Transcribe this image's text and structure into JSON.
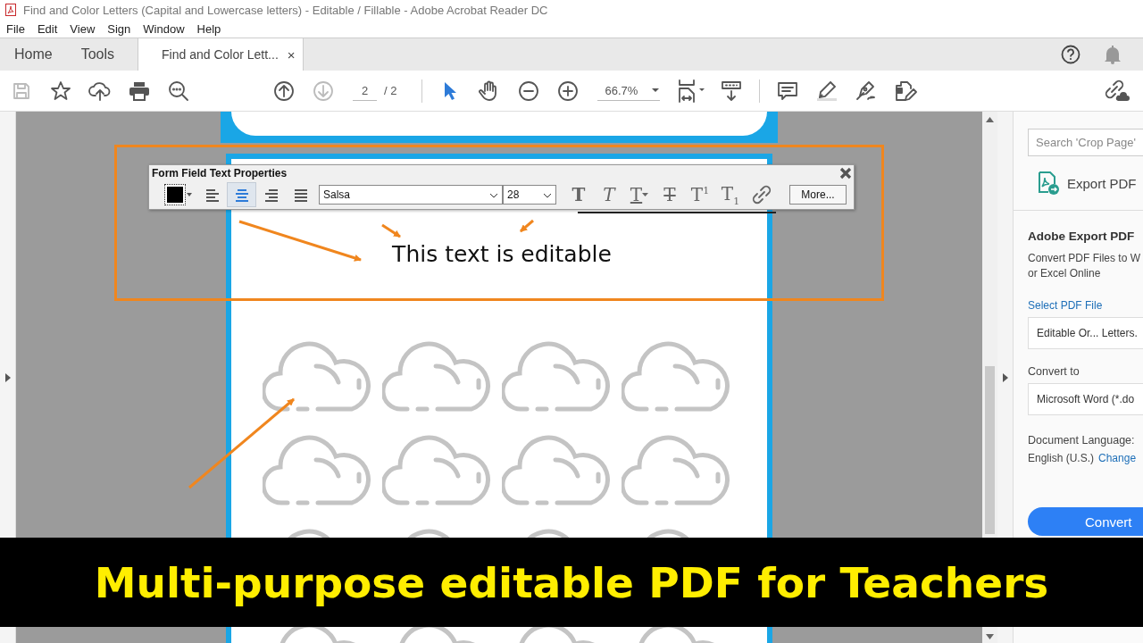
{
  "window": {
    "title": "Find and Color Letters (Capital and Lowercase letters) - Editable / Fillable - Adobe Acrobat Reader DC"
  },
  "menu": [
    "File",
    "Edit",
    "View",
    "Sign",
    "Window",
    "Help"
  ],
  "tabs": [
    {
      "label": "Home",
      "selected": false
    },
    {
      "label": "Tools",
      "selected": false
    },
    {
      "label": "Find and Color Lett...",
      "selected": true,
      "close": "×"
    }
  ],
  "toolbar": {
    "tools": [
      {
        "kind": "save",
        "disabled": true
      },
      {
        "kind": "star",
        "disabled": false
      },
      {
        "kind": "upload",
        "disabled": false
      },
      {
        "kind": "print",
        "disabled": false
      },
      {
        "kind": "find",
        "disabled": false
      }
    ],
    "nav": [
      {
        "kind": "up",
        "disabled": false
      },
      {
        "kind": "down",
        "disabled": true
      }
    ],
    "page": "2",
    "page_total": "/ 2",
    "modes": [
      {
        "kind": "select",
        "selected": true
      },
      {
        "kind": "hand",
        "selected": false
      }
    ],
    "zoom": "66.7%"
  },
  "form_toolbar": {
    "title": "Form Field Text Properties",
    "align": [
      {
        "kind": "left",
        "selected": false
      },
      {
        "kind": "center",
        "selected": true
      },
      {
        "kind": "right",
        "selected": false
      },
      {
        "kind": "justify",
        "selected": false
      }
    ],
    "font": "Salsa",
    "size": "28",
    "styles": [
      {
        "kind": "bold",
        "glyph": "T"
      },
      {
        "kind": "italic",
        "glyph": "T"
      },
      {
        "kind": "underline",
        "glyph": "T"
      },
      {
        "kind": "strike",
        "glyph": "T"
      },
      {
        "kind": "super",
        "glyph": "T$^{1}$"
      },
      {
        "kind": "sub",
        "glyph": "T$_{1}$"
      }
    ],
    "more": "More..."
  },
  "document": {
    "editable_text": "This text is editable"
  },
  "side_panel": {
    "search_placeholder": "Search 'Crop Page'",
    "tool": "Export PDF",
    "heading": "Adobe Export PDF",
    "description_lines": [
      "Convert PDF Files to W",
      "or Excel Online"
    ],
    "select_link": "Select PDF File",
    "file": "Editable Or... Letters.",
    "convert_label": "Convert to",
    "format": "Microsoft Word (*.do",
    "language_label": "Document Language:",
    "language": "English (U.S.)",
    "change_link": "Change",
    "convert_button": "Convert"
  },
  "banner": {
    "text": "Multi-purpose editable PDF for Teachers"
  }
}
